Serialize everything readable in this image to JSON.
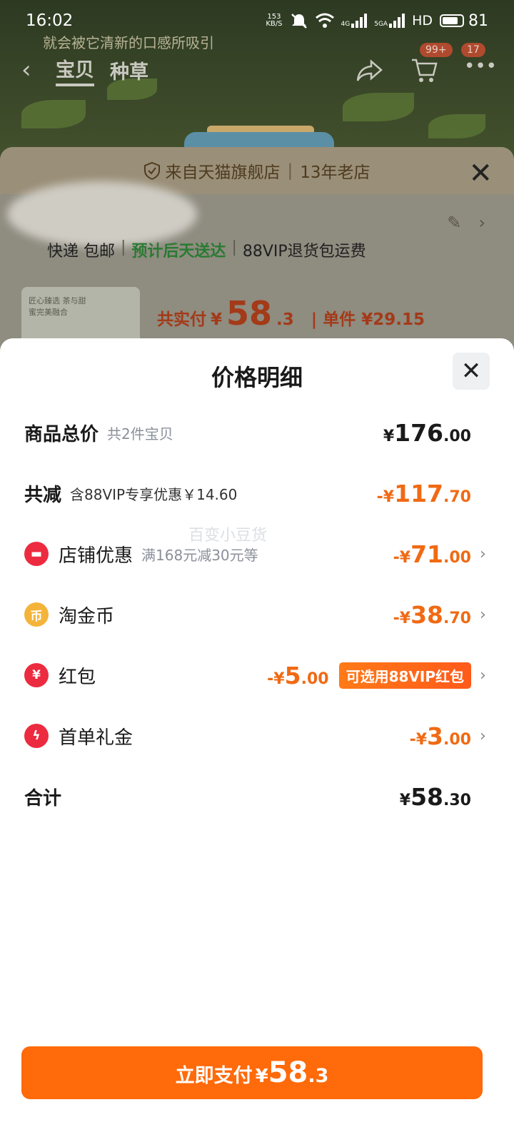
{
  "status_bar": {
    "time": "16:02",
    "net_speed_value": "153",
    "net_speed_unit": "KB/S",
    "signal_4g": "4G",
    "signal_5g": "5GA",
    "hd": "HD",
    "battery": "81"
  },
  "background": {
    "caption": "就会被它清新的口感所吸引"
  },
  "nav": {
    "tab_item": "宝贝",
    "tab_grass": "种草",
    "cart_badge": "99+",
    "more_badge": "17"
  },
  "order_sheet": {
    "shop_source": "来自天猫旗舰店",
    "shop_age": "13年老店",
    "shipping": "快递 包邮",
    "eta": "预计后天送达",
    "return_policy": "88VIP退货包运费",
    "product_image_text": "匠心臻选 茶与甜蜜完美融合",
    "paid_label": "共实付",
    "paid_yen": "¥",
    "paid_int": "58",
    "paid_dec": ".3",
    "unit_label": "单件",
    "unit_price": "¥29.15"
  },
  "price_detail": {
    "title": "价格明细",
    "watermark": "百变小豆货",
    "total_label": "商品总价",
    "total_sub": "共2件宝贝",
    "total_yen": "¥",
    "total_int": "176",
    "total_dec": ".00",
    "discount_label": "共减",
    "discount_sub": "含88VIP专享优惠￥14.60",
    "discount_yen": "-¥",
    "discount_int": "117",
    "discount_dec": ".70",
    "shop_label": "店铺优惠",
    "shop_sub": "满168元减30元等",
    "shop_yen": "-¥",
    "shop_int": "71",
    "shop_dec": ".00",
    "coin_label": "淘金币",
    "coin_yen": "-¥",
    "coin_int": "38",
    "coin_dec": ".70",
    "redpacket_label": "红包",
    "redpacket_yen": "-¥",
    "redpacket_int": "5",
    "redpacket_dec": ".00",
    "redpacket_tag": "可选用88VIP红包",
    "firstorder_label": "首单礼金",
    "firstorder_yen": "-¥",
    "firstorder_int": "3",
    "firstorder_dec": ".00",
    "sum_label": "合计",
    "sum_yen": "¥",
    "sum_int": "58",
    "sum_dec": ".30"
  },
  "pay_button": {
    "label": "立即支付",
    "yen": "¥",
    "int": "58",
    "dec": ".3"
  },
  "icons": {
    "shop": "store-icon",
    "coin": "coin-icon",
    "redpacket": "red-packet-icon",
    "firstorder": "lightning-icon"
  },
  "colors": {
    "accent": "#ff6a0a",
    "discount": "#f06a14",
    "icon_red": "#ec2b40",
    "icon_gold": "#f4b43a"
  }
}
